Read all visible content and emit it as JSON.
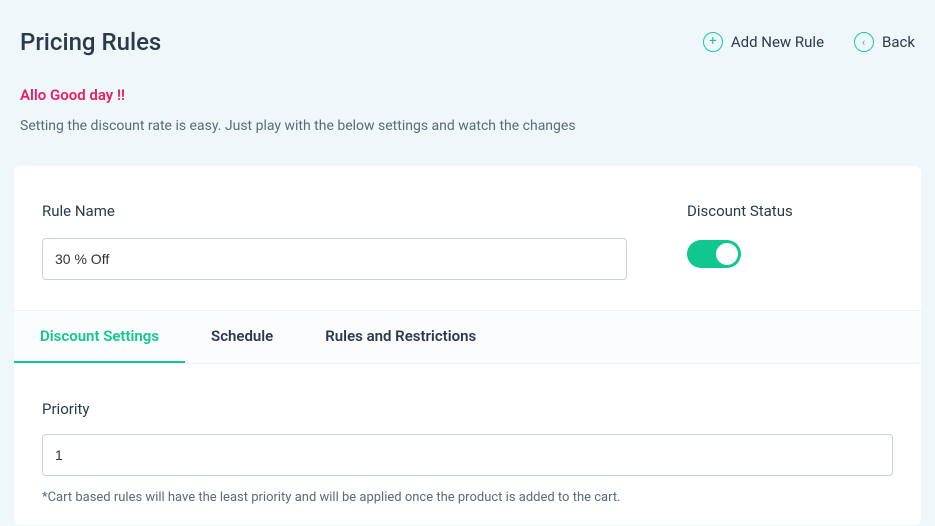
{
  "header": {
    "title": "Pricing Rules",
    "add_label": "Add New Rule",
    "back_label": "Back"
  },
  "intro": {
    "greeting": "Allo Good day !!",
    "subtext": "Setting the discount rate is easy. Just play with the below settings and watch the changes"
  },
  "form": {
    "rule_name_label": "Rule Name",
    "rule_name_value": "30 % Off",
    "discount_status_label": "Discount Status",
    "discount_status_on": true
  },
  "tabs": {
    "items": [
      {
        "label": "Discount Settings"
      },
      {
        "label": "Schedule"
      },
      {
        "label": "Rules and Restrictions"
      }
    ],
    "active_index": 0
  },
  "priority": {
    "label": "Priority",
    "value": "1",
    "hint": "*Cart based rules will have the least priority and will be applied once the product is added to the cart."
  }
}
